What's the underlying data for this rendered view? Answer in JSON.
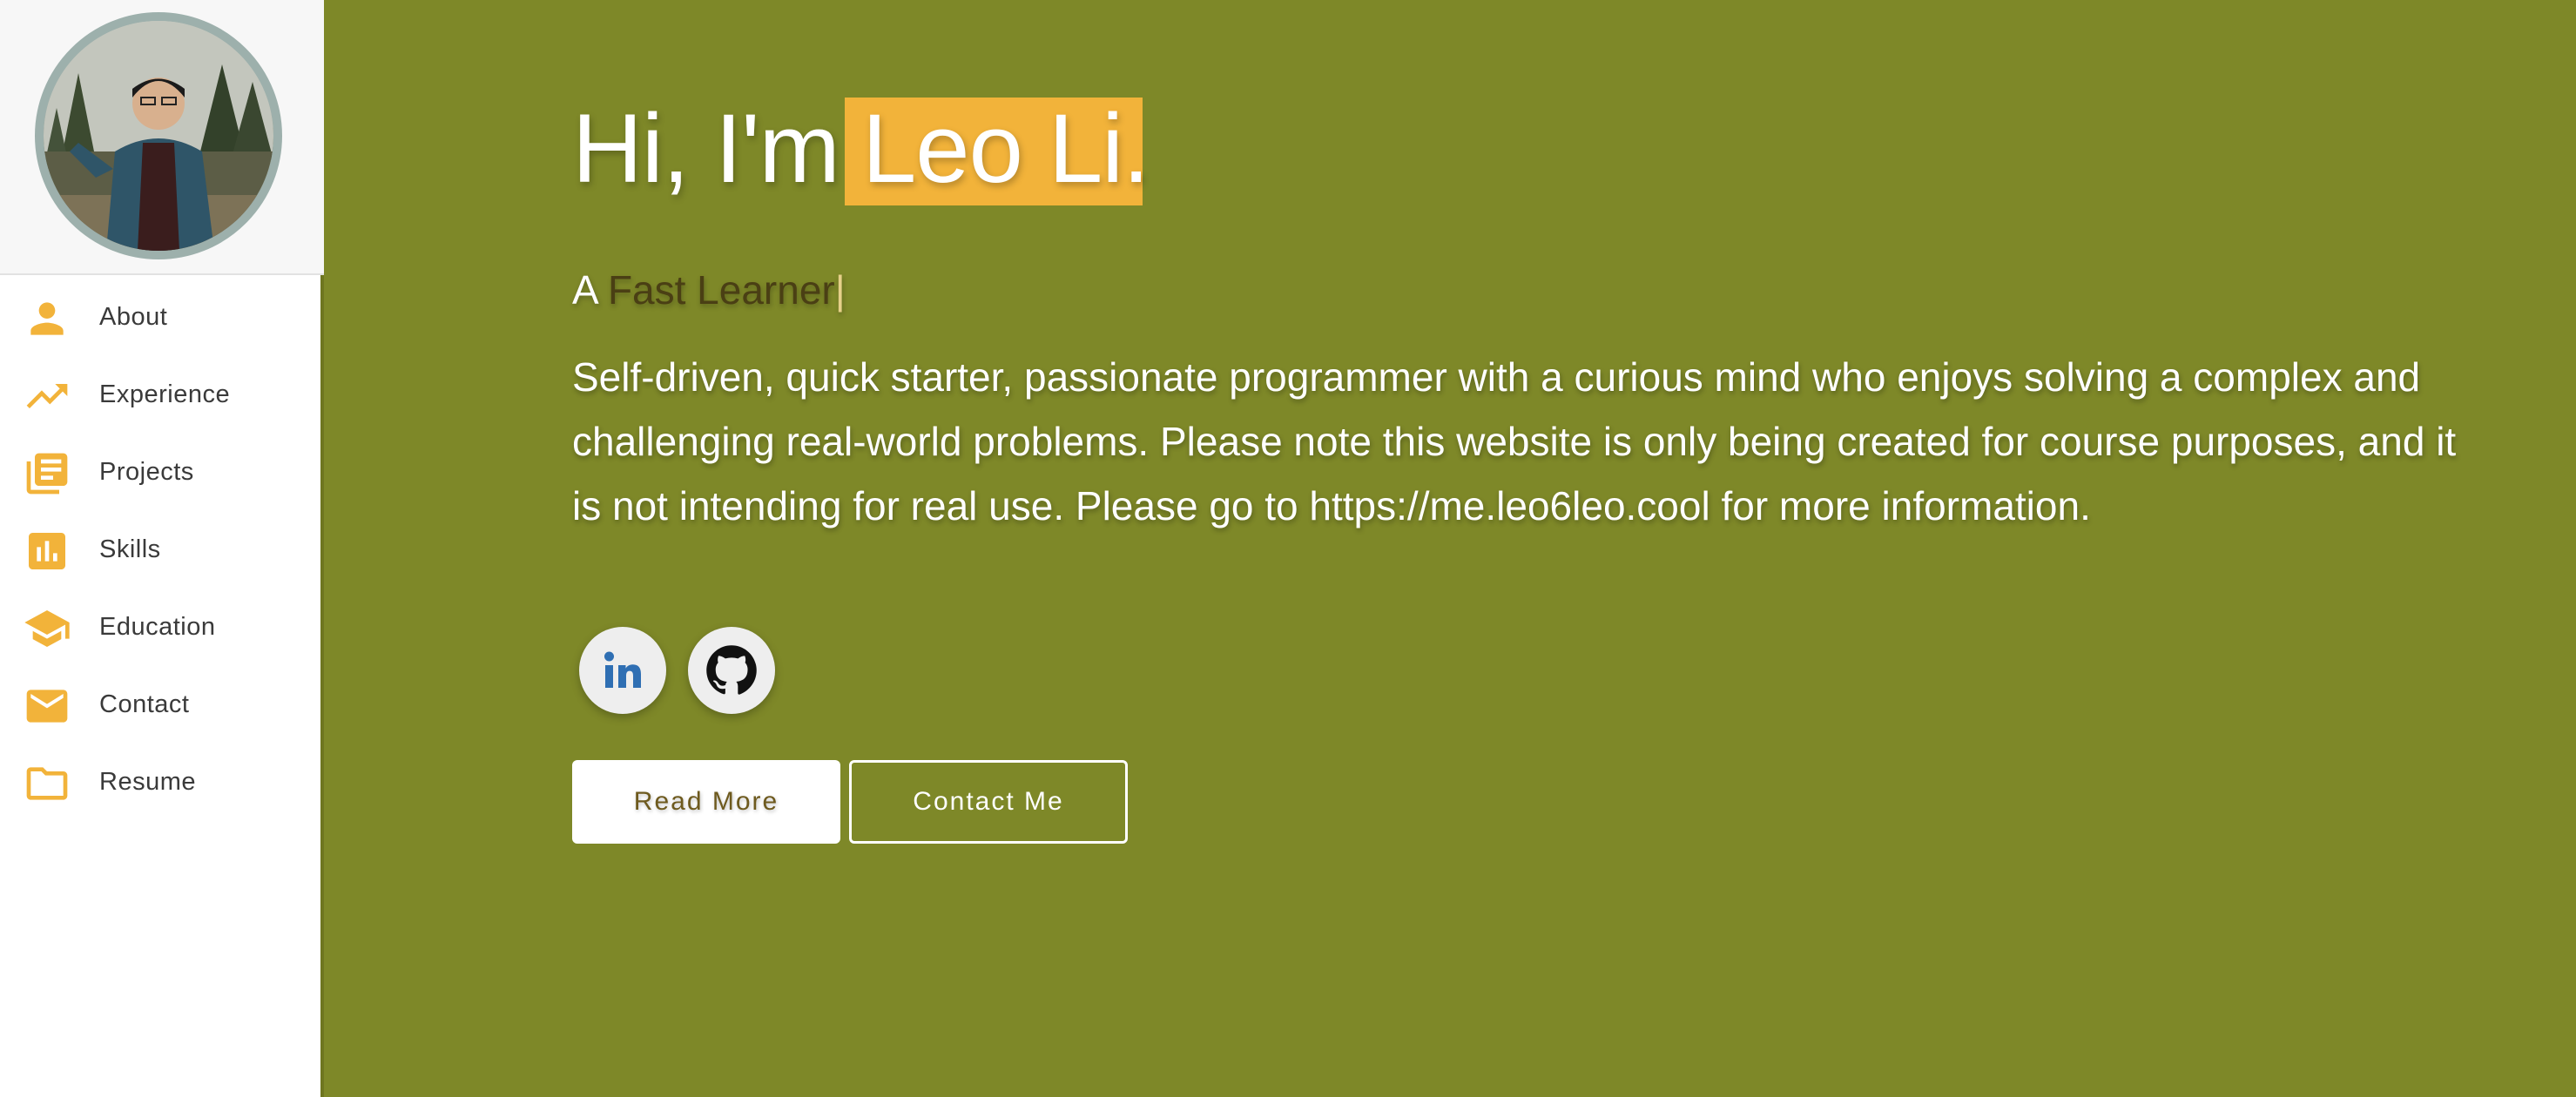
{
  "colors": {
    "main_background": "#7e8828",
    "accent": "#f2b33a",
    "sidebar_background": "#ffffff",
    "avatar_border": "#9db0ac"
  },
  "sidebar": {
    "avatar_alt": "profile-photo",
    "items": [
      {
        "label": "About",
        "icon": "person-icon"
      },
      {
        "label": "Experience",
        "icon": "trending-up-icon"
      },
      {
        "label": "Projects",
        "icon": "library-books-icon"
      },
      {
        "label": "Skills",
        "icon": "bar-chart-icon"
      },
      {
        "label": "Education",
        "icon": "school-icon"
      },
      {
        "label": "Contact",
        "icon": "mail-icon"
      },
      {
        "label": "Resume",
        "icon": "folder-icon"
      }
    ]
  },
  "hero": {
    "greeting": "Hi, I'm",
    "name": "Leo Li.",
    "tagline_prefix": "A",
    "tagline_typed": "Fast Learner",
    "tagline_cursor": "|",
    "bio": "Self-driven, quick starter, passionate programmer with a curious mind who enjoys solving a complex and challenging real-world problems. Please note this website is only being created for course purposes, and it is not intending for real use. Please go to https://me.leo6leo.cool for more information.",
    "social": [
      {
        "name": "linkedin",
        "icon": "linkedin-icon"
      },
      {
        "name": "github",
        "icon": "github-icon"
      }
    ],
    "buttons": {
      "read_more": "Read More",
      "contact_me": "Contact Me"
    }
  }
}
